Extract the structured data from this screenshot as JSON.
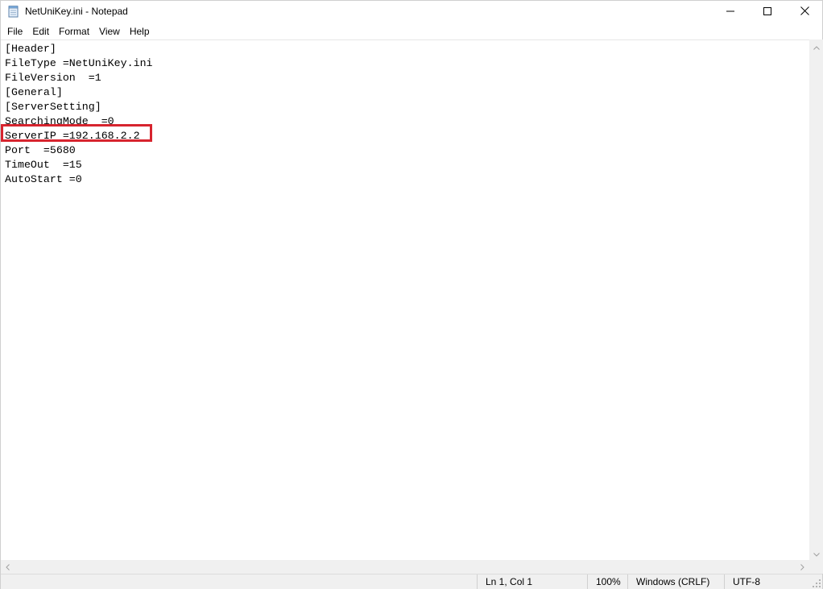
{
  "window": {
    "title": "NetUniKey.ini - Notepad"
  },
  "icons": {
    "app": "notepad-icon",
    "minimize": "minimize-icon",
    "maximize": "maximize-icon",
    "close": "close-icon"
  },
  "menu": {
    "items": [
      "File",
      "Edit",
      "Format",
      "View",
      "Help"
    ]
  },
  "editor": {
    "content": "[Header]\nFileType =NetUniKey.ini\nFileVersion  =1\n[General]\n[ServerSetting]\nSearchingMode  =0\nServerIP =192.168.2.2\nPort  =5680\nTimeOut  =15\nAutoStart =0",
    "highlight_color": "#d7242e"
  },
  "status": {
    "position": "Ln 1, Col 1",
    "zoom": "100%",
    "line_ending": "Windows (CRLF)",
    "encoding": "UTF-8"
  }
}
